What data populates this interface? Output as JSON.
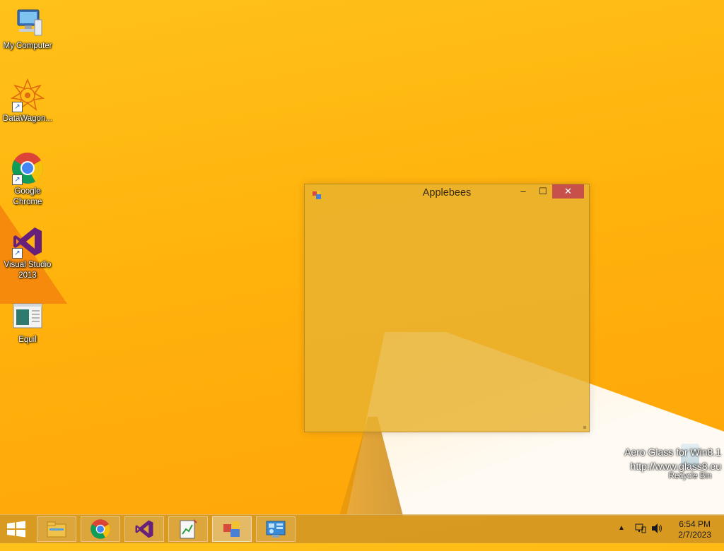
{
  "desktop": {
    "icons": [
      {
        "label": "My Computer",
        "icon": "my-computer-icon"
      },
      {
        "label": "DataWagon...",
        "icon": "datawagon-icon"
      },
      {
        "label": "Google Chrome",
        "icon": "chrome-icon"
      },
      {
        "label": "Visual Studio 2013",
        "icon": "visual-studio-icon"
      },
      {
        "label": "Equil",
        "icon": "equil-icon"
      }
    ],
    "recycle_bin": {
      "label": "Recycle Bin",
      "icon": "recycle-bin-icon"
    },
    "watermark": {
      "line1": "Aero Glass for Win8.1",
      "line2": "http://www.glass8.eu"
    }
  },
  "window": {
    "title": "Applebees",
    "minimize_glyph": "–",
    "maximize_glyph": "☐",
    "close_glyph": "✕"
  },
  "taskbar": {
    "apps": [
      {
        "name": "File Explorer",
        "icon": "file-explorer-icon",
        "active": false
      },
      {
        "name": "Google Chrome",
        "icon": "chrome-icon",
        "active": false
      },
      {
        "name": "Visual Studio",
        "icon": "visual-studio-icon",
        "active": false
      },
      {
        "name": "Equil",
        "icon": "equil-icon",
        "active": false
      },
      {
        "name": "Applebees",
        "icon": "winforms-app-icon",
        "active": true
      },
      {
        "name": "Control Panel",
        "icon": "control-panel-icon",
        "active": false
      }
    ],
    "tray": {
      "time": "6:54 PM",
      "date": "2/7/2023"
    }
  },
  "colors": {
    "accent_close": "#c7504b",
    "wallpaper": "#ffb20c"
  }
}
